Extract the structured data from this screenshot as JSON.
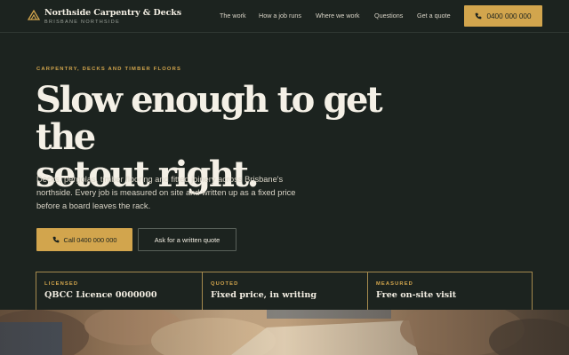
{
  "header": {
    "brand_name": "Northside Carpentry & Decks",
    "brand_sub": "BRISBANE NORTHSIDE",
    "nav": [
      "The work",
      "How a job runs",
      "Where we work",
      "Questions",
      "Get a quote"
    ],
    "phone": "0400 000 000"
  },
  "hero": {
    "eyebrow": "CARPENTRY, DECKS AND TIMBER FLOORS",
    "headline_line1": "Slow enough to get the",
    "headline_line2": "setout right.",
    "lede": "Decks, pergolas, timber flooring and fitted joinery across Brisbane's northside. Every job is measured on site and written up as a fixed price before a board leaves the rack.",
    "call_button": "Call 0400 000 000",
    "quote_button": "Ask for a written quote"
  },
  "facts": [
    {
      "label": "LICENSED",
      "value": "QBCC Licence 0000000"
    },
    {
      "label": "QUOTED",
      "value": "Fixed price, in writing"
    },
    {
      "label": "MEASURED",
      "value": "Free on-site visit"
    }
  ],
  "colors": {
    "background": "#1c231f",
    "accent": "#d2a54d",
    "text": "#f4f0e6"
  },
  "icons": {
    "brand": "roof-triangle-icon",
    "phone": "phone-icon"
  }
}
